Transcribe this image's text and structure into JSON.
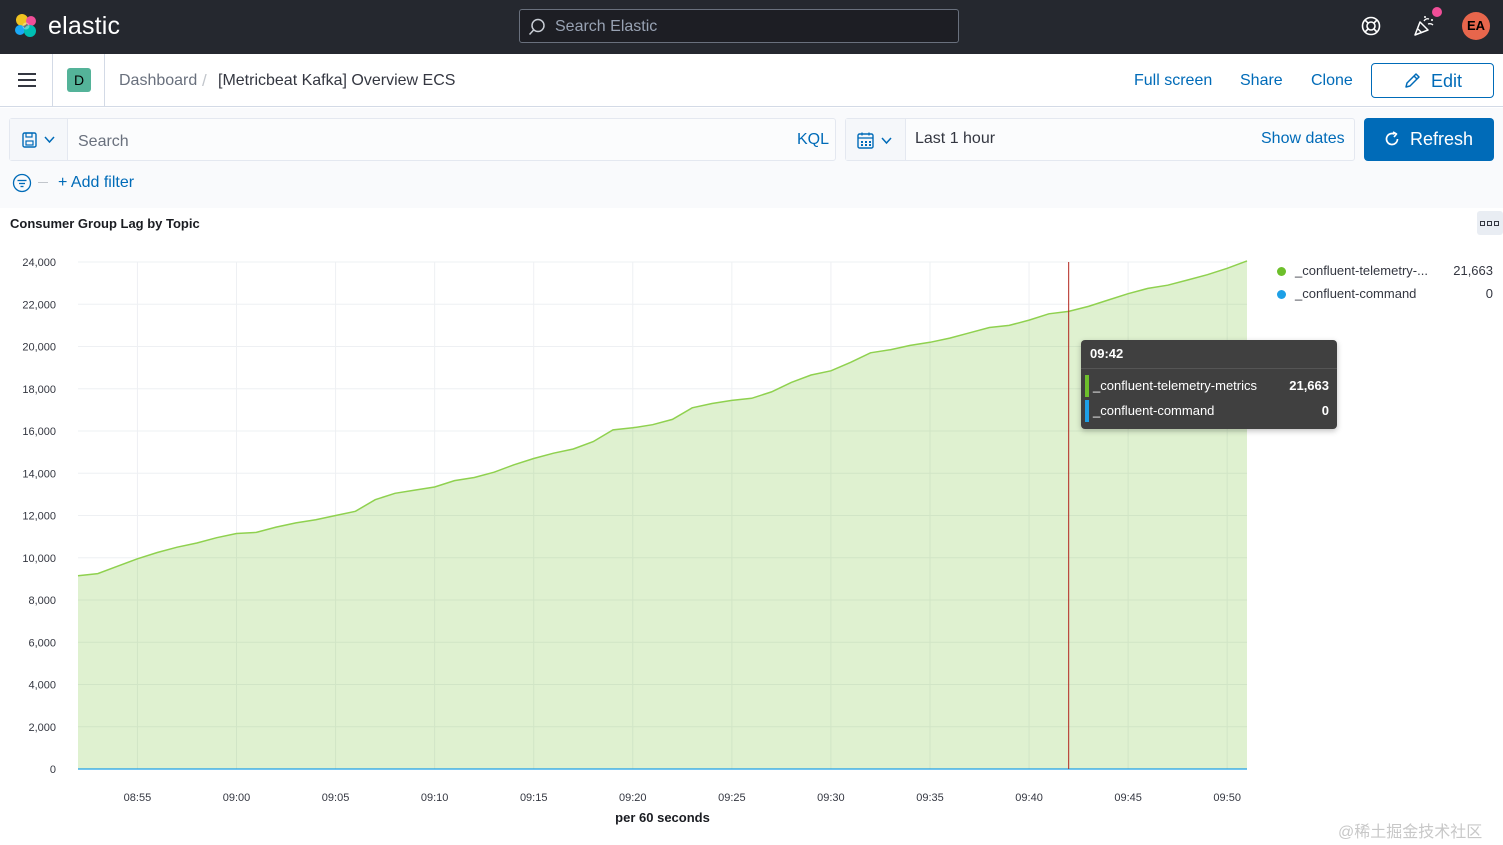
{
  "header": {
    "brand": "elastic",
    "search_placeholder": "Search Elastic",
    "avatar_initials": "EA"
  },
  "nav": {
    "space_initial": "D",
    "breadcrumb_root": "Dashboard",
    "breadcrumb_current": "[Metricbeat Kafka] Overview ECS",
    "links": [
      "Full screen",
      "Share",
      "Clone"
    ],
    "edit_label": "Edit"
  },
  "query": {
    "search_placeholder": "Search",
    "language": "KQL",
    "time_range": "Last 1 hour",
    "show_dates": "Show dates",
    "refresh_label": "Refresh",
    "add_filter": "+ Add filter"
  },
  "panel": {
    "title": "Consumer Group Lag by Topic"
  },
  "legend": [
    {
      "name": "_confluent-telemetry-...",
      "value": "21,663",
      "color": "#6dbf2b"
    },
    {
      "name": "_confluent-command",
      "value": "0",
      "color": "#1ea0e6"
    }
  ],
  "tooltip": {
    "time": "09:42",
    "rows": [
      {
        "name": "_confluent-telemetry-metrics",
        "value": "21,663",
        "color": "#6dbf2b"
      },
      {
        "name": "_confluent-command",
        "value": "0",
        "color": "#1ea0e6"
      }
    ]
  },
  "watermark": "@稀土掘金技术社区",
  "chart_data": {
    "type": "area",
    "title": "Consumer Group Lag by Topic",
    "xlabel": "per 60 seconds",
    "ylabel": "",
    "ylim": [
      0,
      24000
    ],
    "yticks": [
      0,
      2000,
      4000,
      6000,
      8000,
      10000,
      12000,
      14000,
      16000,
      18000,
      20000,
      22000,
      24000
    ],
    "ytick_labels": [
      "0",
      "2,000",
      "4,000",
      "6,000",
      "8,000",
      "10,000",
      "12,000",
      "14,000",
      "16,000",
      "18,000",
      "20,000",
      "22,000",
      "24,000"
    ],
    "xtick_labels": [
      "08:55",
      "09:00",
      "09:05",
      "09:10",
      "09:15",
      "09:20",
      "09:25",
      "09:30",
      "09:35",
      "09:40",
      "09:45",
      "09:50"
    ],
    "x_start": "08:52",
    "x_end": "09:51",
    "crosshair": "09:42",
    "grid": true,
    "legend_position": "right",
    "series": [
      {
        "name": "_confluent-telemetry-metrics",
        "color": "#6dbf2b",
        "x": [
          "08:52",
          "08:53",
          "08:54",
          "08:55",
          "08:56",
          "08:57",
          "08:58",
          "08:59",
          "09:00",
          "09:01",
          "09:02",
          "09:03",
          "09:04",
          "09:05",
          "09:06",
          "09:07",
          "09:08",
          "09:09",
          "09:10",
          "09:11",
          "09:12",
          "09:13",
          "09:14",
          "09:15",
          "09:16",
          "09:17",
          "09:18",
          "09:19",
          "09:20",
          "09:21",
          "09:22",
          "09:23",
          "09:24",
          "09:25",
          "09:26",
          "09:27",
          "09:28",
          "09:29",
          "09:30",
          "09:31",
          "09:32",
          "09:33",
          "09:34",
          "09:35",
          "09:36",
          "09:37",
          "09:38",
          "09:39",
          "09:40",
          "09:41",
          "09:42",
          "09:43",
          "09:44",
          "09:45",
          "09:46",
          "09:47",
          "09:48",
          "09:49",
          "09:50",
          "09:51"
        ],
        "values": [
          9150,
          9250,
          9600,
          9950,
          10250,
          10500,
          10700,
          10950,
          11150,
          11200,
          11450,
          11650,
          11800,
          12000,
          12200,
          12750,
          13050,
          13200,
          13350,
          13650,
          13800,
          14050,
          14400,
          14700,
          14950,
          15150,
          15500,
          16050,
          16150,
          16300,
          16550,
          17100,
          17300,
          17450,
          17550,
          17850,
          18300,
          18650,
          18850,
          19250,
          19700,
          19850,
          20050,
          20200,
          20400,
          20650,
          20900,
          21000,
          21250,
          21550,
          21663,
          21900,
          22200,
          22500,
          22750,
          22900,
          23150,
          23400,
          23700,
          24050
        ]
      },
      {
        "name": "_confluent-command",
        "color": "#1ea0e6",
        "x": [
          "08:52",
          "09:51"
        ],
        "values": [
          0,
          0
        ]
      }
    ]
  }
}
